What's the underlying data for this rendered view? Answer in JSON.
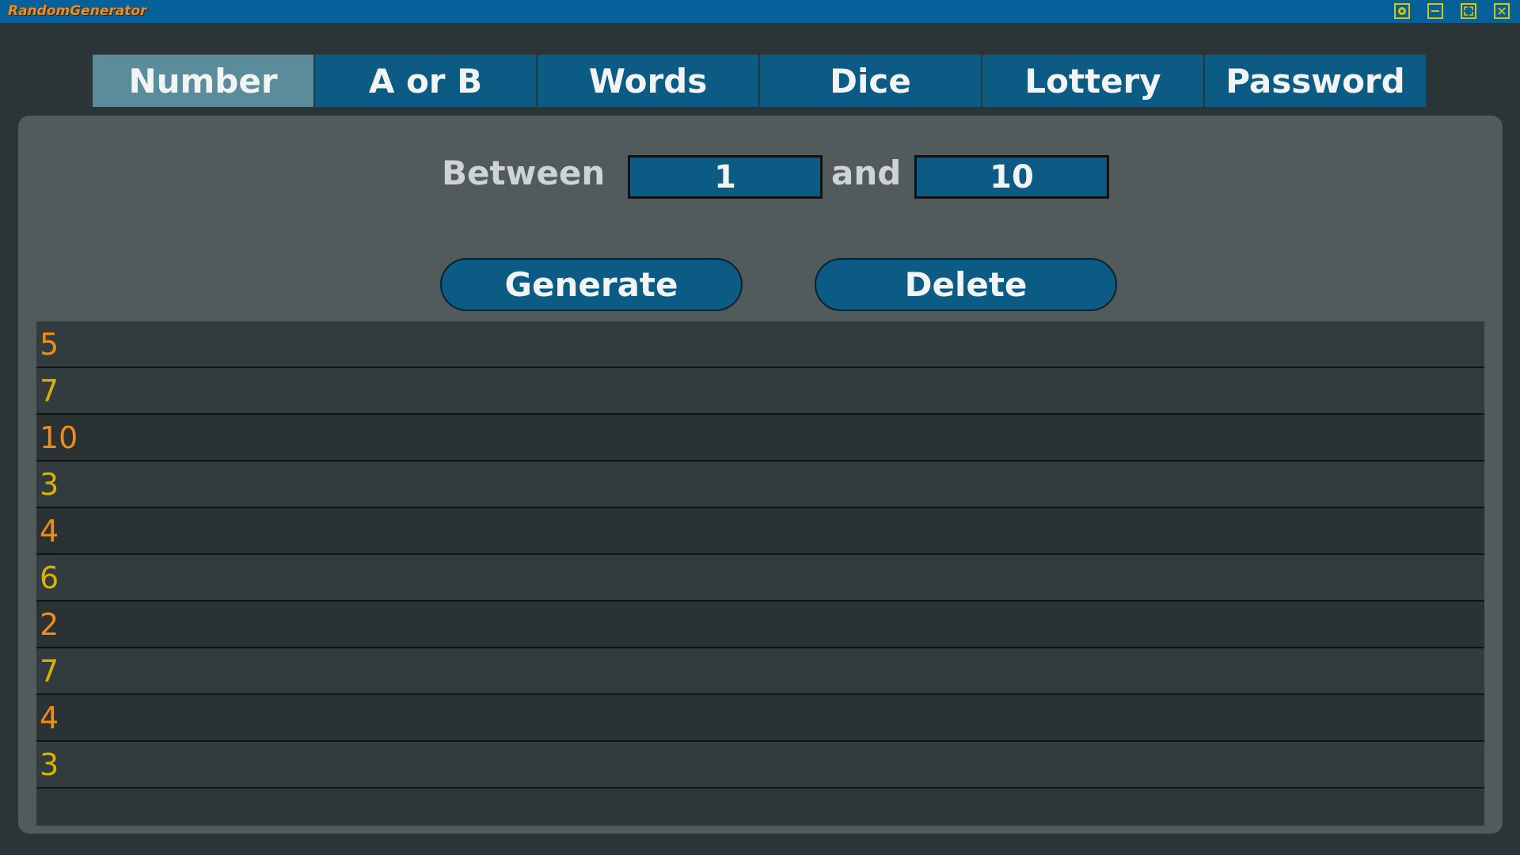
{
  "window": {
    "title": "RandomGenerator",
    "controls": [
      "settings-icon",
      "minimize-icon",
      "maximize-icon",
      "close-icon"
    ],
    "accent_color": "#d8c400"
  },
  "tabs": [
    {
      "label": "Number",
      "active": true
    },
    {
      "label": "A or B",
      "active": false
    },
    {
      "label": "Words",
      "active": false
    },
    {
      "label": "Dice",
      "active": false
    },
    {
      "label": "Lottery",
      "active": false
    },
    {
      "label": "Password",
      "active": false
    }
  ],
  "range": {
    "between_label": "Between",
    "and_label": "and",
    "min_value": "1",
    "max_value": "10"
  },
  "buttons": {
    "generate_label": "Generate",
    "delete_label": "Delete"
  },
  "results": [
    {
      "value": "5",
      "color": "orange"
    },
    {
      "value": "7",
      "color": "yellow"
    },
    {
      "value": "10",
      "color": "orange"
    },
    {
      "value": "3",
      "color": "yellow"
    },
    {
      "value": "4",
      "color": "orange"
    },
    {
      "value": "6",
      "color": "yellow"
    },
    {
      "value": "2",
      "color": "orange"
    },
    {
      "value": "7",
      "color": "yellow"
    },
    {
      "value": "4",
      "color": "orange"
    },
    {
      "value": "3",
      "color": "yellow"
    }
  ],
  "colors": {
    "titlebar": "#06619a",
    "tab": "#0b5b84",
    "tab_active": "#5a8c9c",
    "value_orange": "#f08c16",
    "value_yellow": "#d8b400"
  }
}
